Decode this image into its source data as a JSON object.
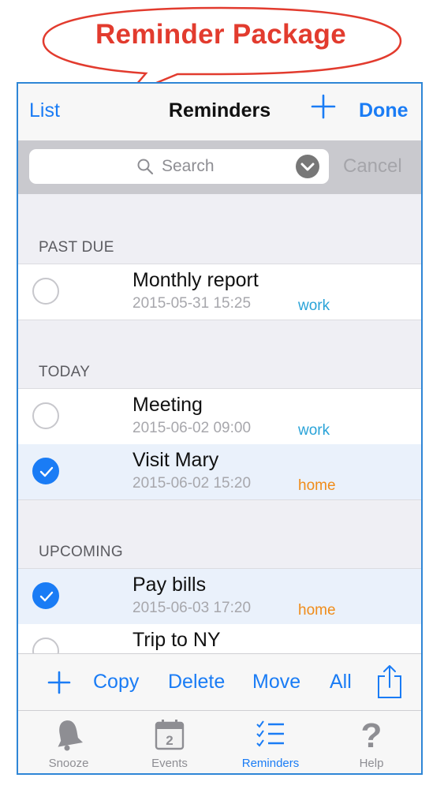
{
  "callout": {
    "text": "Reminder Package"
  },
  "navbar": {
    "left": "List",
    "title": "Reminders",
    "right": "Done",
    "add_icon": "plus-icon"
  },
  "search": {
    "placeholder": "Search",
    "cancel": "Cancel"
  },
  "sections": [
    {
      "header": "PAST DUE",
      "items": [
        {
          "title": "Monthly report",
          "date": "2015-05-31 15:25",
          "tag": "work",
          "checked": false
        }
      ]
    },
    {
      "header": "TODAY",
      "items": [
        {
          "title": "Meeting",
          "date": "2015-06-02 09:00",
          "tag": "work",
          "checked": false
        },
        {
          "title": "Visit Mary",
          "date": "2015-06-02 15:20",
          "tag": "home",
          "checked": true
        }
      ]
    },
    {
      "header": "UPCOMING",
      "items": [
        {
          "title": "Pay bills",
          "date": "2015-06-03 17:20",
          "tag": "home",
          "checked": true
        },
        {
          "title": "Trip to NY",
          "date": "",
          "tag": "",
          "checked": false
        }
      ]
    }
  ],
  "toolbar": {
    "copy": "Copy",
    "delete": "Delete",
    "move": "Move",
    "all": "All"
  },
  "tabs": [
    {
      "label": "Snooze",
      "icon": "bell-icon"
    },
    {
      "label": "Events",
      "icon": "calendar-icon"
    },
    {
      "label": "Reminders",
      "icon": "list-icon"
    },
    {
      "label": "Help",
      "icon": "question-icon"
    }
  ],
  "colors": {
    "accent": "#1a7cf5",
    "work_tag": "#2aa3d8",
    "home_tag": "#f08c1a",
    "callout": "#e23b2e",
    "frame": "#2f86d6"
  }
}
